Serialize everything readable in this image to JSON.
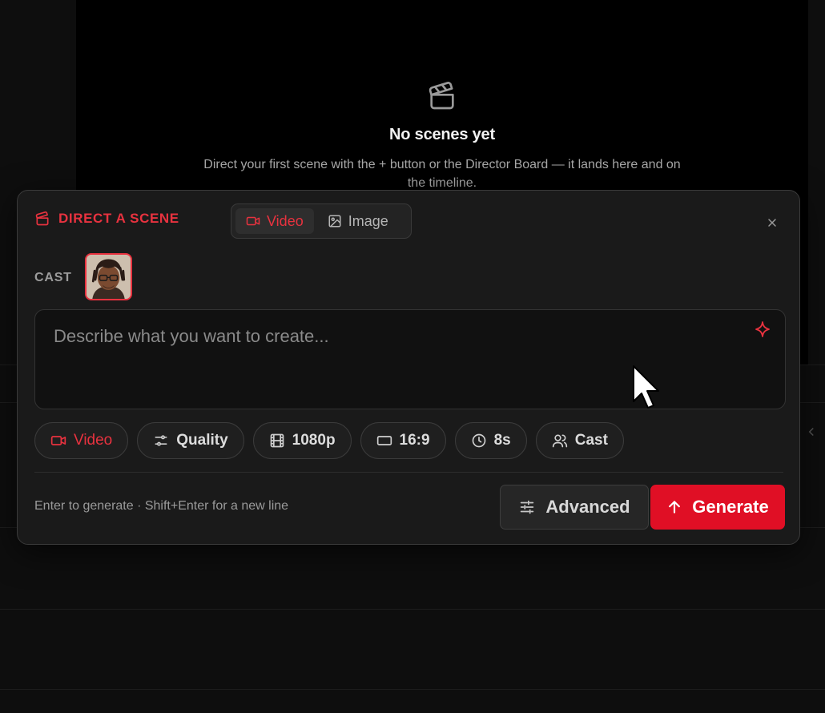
{
  "empty_state": {
    "title": "No scenes yet",
    "description": "Direct your first scene with the + button or the Director Board — it lands here and on the timeline.",
    "icon": "clapperboard-icon"
  },
  "dialog": {
    "title": "DIRECT A SCENE",
    "title_icon": "clapperboard-icon",
    "accent_color": "#e8323f",
    "mode_toggle": {
      "options": [
        {
          "label": "Video",
          "icon": "video-icon",
          "active": true
        },
        {
          "label": "Image",
          "icon": "image-icon",
          "active": false
        }
      ]
    },
    "close_icon": "close-icon",
    "cast": {
      "label": "CAST",
      "members": [
        {
          "icon": "avatar"
        }
      ]
    },
    "prompt": {
      "value": "",
      "placeholder": "Describe what you want to create...",
      "enhance_icon": "sparkle-icon"
    },
    "chips": [
      {
        "label": "Video",
        "icon": "video-icon"
      },
      {
        "label": "Quality",
        "icon": "sliders-icon"
      },
      {
        "label": "1080p",
        "icon": "film-icon"
      },
      {
        "label": "16:9",
        "icon": "aspect-ratio-icon"
      },
      {
        "label": "8s",
        "icon": "clock-icon"
      },
      {
        "label": "Cast",
        "icon": "users-icon"
      }
    ],
    "hint": "Enter to generate · Shift+Enter for a new line",
    "advanced_label": "Advanced",
    "generate_label": "Generate",
    "generate_color": "#e00f25"
  }
}
